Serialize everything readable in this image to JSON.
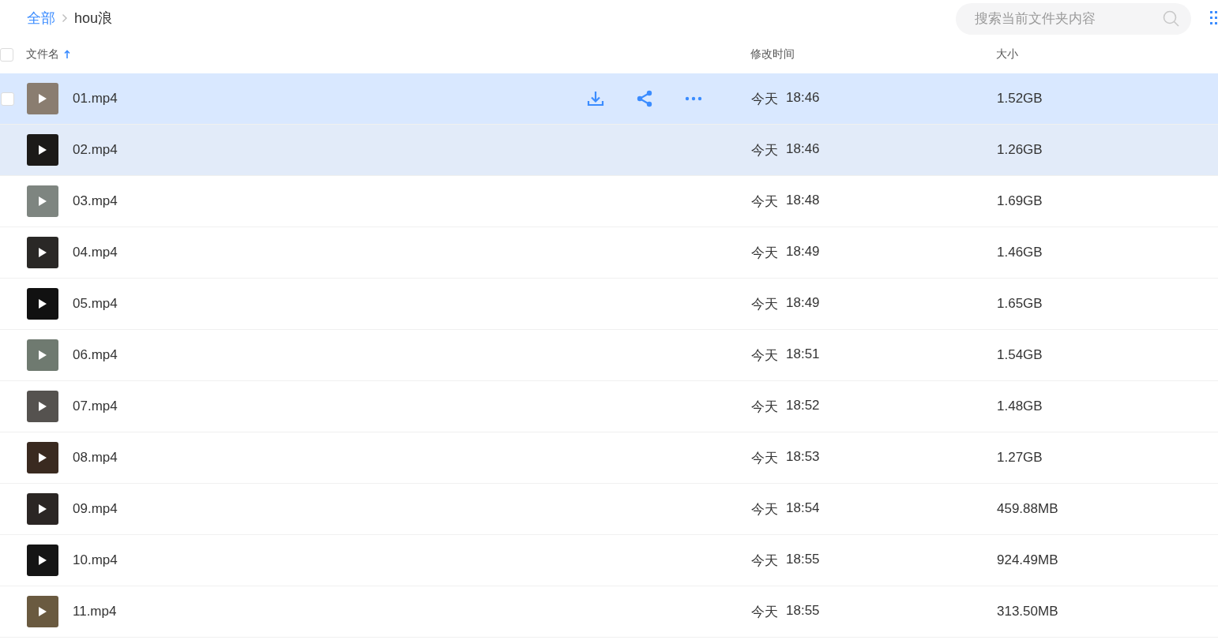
{
  "breadcrumb": [
    {
      "label": "全部",
      "link": true
    },
    {
      "label": "hou浪",
      "link": false
    }
  ],
  "search": {
    "placeholder": "搜索当前文件夹内容"
  },
  "header": {
    "select_all_checked": false,
    "columns": [
      {
        "label": "文件名",
        "sorted": true
      },
      {
        "label": "修改时间",
        "sorted": false
      },
      {
        "label": "大小",
        "sorted": false
      }
    ]
  },
  "rows": [
    {
      "name": "01.mp4",
      "date": "今天",
      "time": "18:46",
      "size": "1.52GB",
      "hovered": true,
      "highlighted": false,
      "checked": false
    },
    {
      "name": "02.mp4",
      "date": "今天",
      "time": "18:46",
      "size": "1.26GB",
      "hovered": false,
      "highlighted": true,
      "checked": false
    },
    {
      "name": "03.mp4",
      "date": "今天",
      "time": "18:48",
      "size": "1.69GB",
      "hovered": false,
      "highlighted": false,
      "checked": false
    },
    {
      "name": "04.mp4",
      "date": "今天",
      "time": "18:49",
      "size": "1.46GB",
      "hovered": false,
      "highlighted": false,
      "checked": false
    },
    {
      "name": "05.mp4",
      "date": "今天",
      "time": "18:49",
      "size": "1.65GB",
      "hovered": false,
      "highlighted": false,
      "checked": false
    },
    {
      "name": "06.mp4",
      "date": "今天",
      "time": "18:51",
      "size": "1.54GB",
      "hovered": false,
      "highlighted": false,
      "checked": false
    },
    {
      "name": "07.mp4",
      "date": "今天",
      "time": "18:52",
      "size": "1.48GB",
      "hovered": false,
      "highlighted": false,
      "checked": false
    },
    {
      "name": "08.mp4",
      "date": "今天",
      "time": "18:53",
      "size": "1.27GB",
      "hovered": false,
      "highlighted": false,
      "checked": false
    },
    {
      "name": "09.mp4",
      "date": "今天",
      "time": "18:54",
      "size": "459.88MB",
      "hovered": false,
      "highlighted": false,
      "checked": false
    },
    {
      "name": "10.mp4",
      "date": "今天",
      "time": "18:55",
      "size": "924.49MB",
      "hovered": false,
      "highlighted": false,
      "checked": false
    },
    {
      "name": "11.mp4",
      "date": "今天",
      "time": "18:55",
      "size": "313.50MB",
      "hovered": false,
      "highlighted": false,
      "checked": false
    }
  ]
}
